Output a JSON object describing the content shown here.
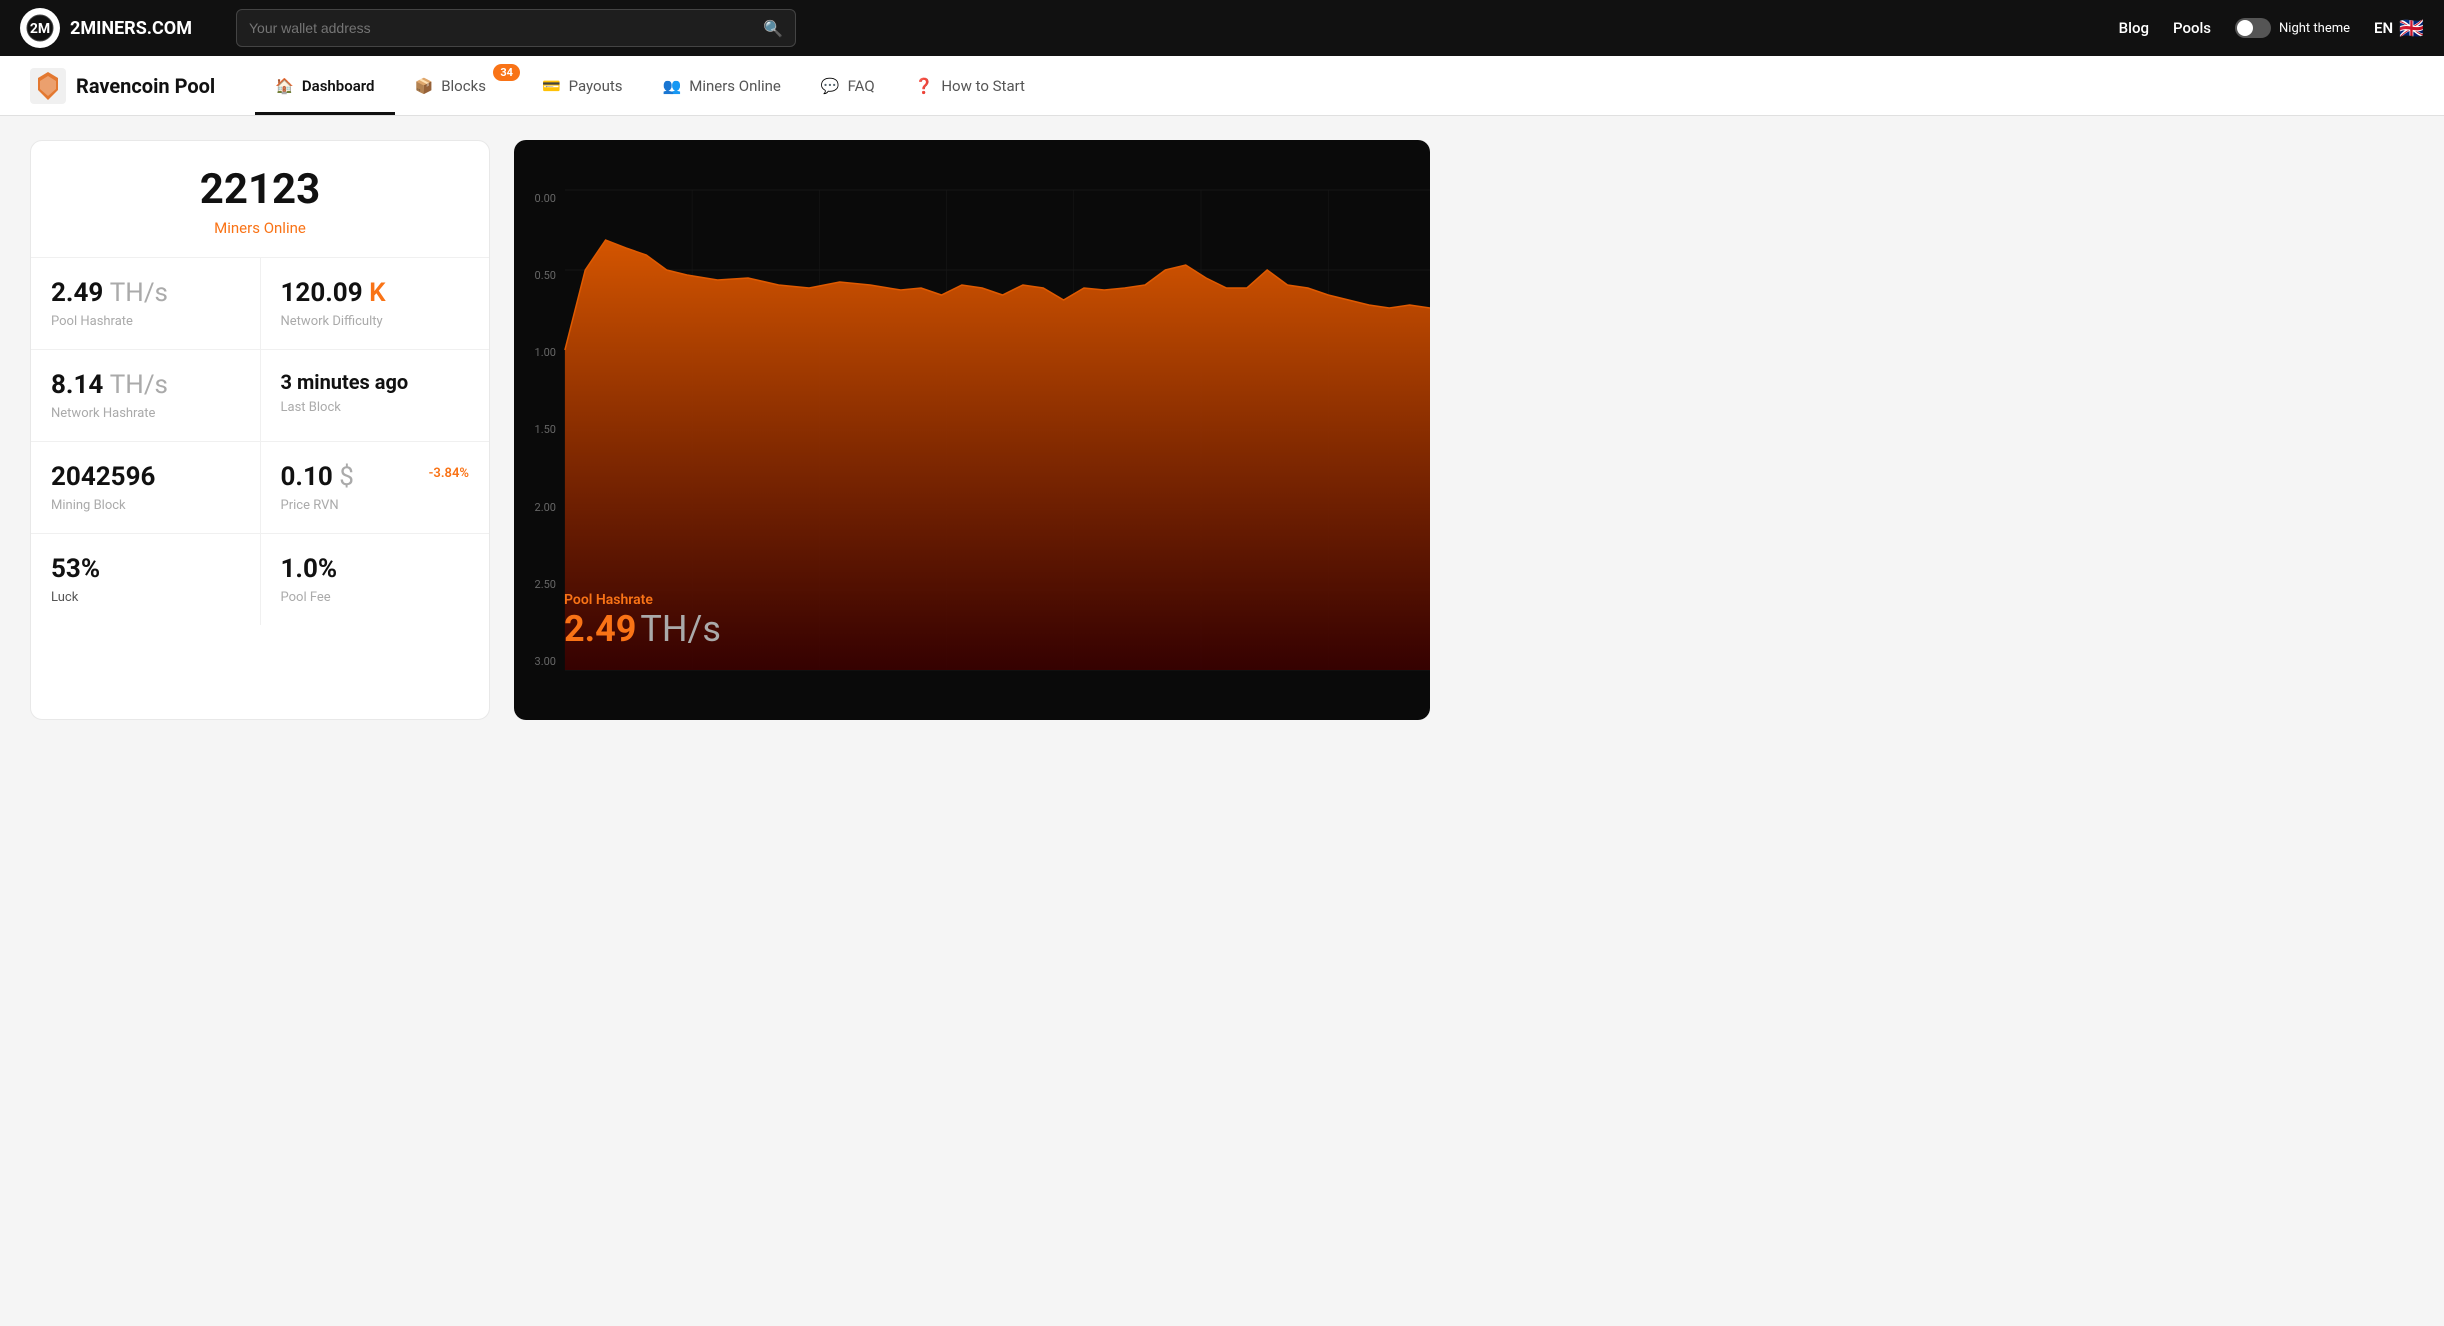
{
  "topnav": {
    "brand": "2MINERS.COM",
    "search_placeholder": "Your wallet address",
    "blog_label": "Blog",
    "pools_label": "Pools",
    "night_theme_label": "Night theme",
    "lang": "EN"
  },
  "subnav": {
    "title": "Ravencoin Pool",
    "tabs": [
      {
        "id": "dashboard",
        "label": "Dashboard",
        "icon": "🏠",
        "active": true,
        "badge": null
      },
      {
        "id": "blocks",
        "label": "Blocks",
        "icon": "📦",
        "active": false,
        "badge": "34"
      },
      {
        "id": "payouts",
        "label": "Payouts",
        "icon": "💳",
        "active": false,
        "badge": null
      },
      {
        "id": "miners-online",
        "label": "Miners Online",
        "icon": "👥",
        "active": false,
        "badge": null
      },
      {
        "id": "faq",
        "label": "FAQ",
        "icon": "💬",
        "active": false,
        "badge": null
      },
      {
        "id": "how-to-start",
        "label": "How to Start",
        "icon": "❓",
        "active": false,
        "badge": null
      }
    ]
  },
  "stats": {
    "miners_count": "22123",
    "miners_label": "Miners",
    "miners_status": "Online",
    "pool_hashrate_value": "2.49",
    "pool_hashrate_unit": "TH/s",
    "pool_hashrate_label": "Pool",
    "pool_hashrate_sublabel": "Hashrate",
    "network_difficulty_value": "120.09",
    "network_difficulty_suffix": "K",
    "network_difficulty_label": "Network",
    "network_difficulty_sublabel": "Difficulty",
    "network_hashrate_value": "8.14",
    "network_hashrate_unit": "TH/s",
    "network_hashrate_label": "Network",
    "network_hashrate_sublabel": "Hashrate",
    "last_block_value": "3 minutes ago",
    "last_block_label": "Last",
    "last_block_sublabel": "Block",
    "mining_block_value": "2042596",
    "mining_block_label": "Mining",
    "mining_block_sublabel": "Block",
    "price_value": "0.10",
    "price_currency": "$",
    "price_label": "Price",
    "price_sublabel": "RVN",
    "price_change": "-3.84%",
    "luck_value": "53%",
    "luck_label": "Luck",
    "pool_fee_value": "1.0%",
    "pool_fee_label": "Pool",
    "pool_fee_sublabel": "Fee"
  },
  "chart": {
    "overlay_label": "Pool Hashrate",
    "overlay_value": "2.49",
    "overlay_unit": "TH/s",
    "y_labels": [
      "0.00",
      "0.50",
      "1.00",
      "1.50",
      "2.00",
      "2.50",
      "3.00"
    ],
    "accent_color": "#c0392b",
    "fill_start": "#d45500",
    "fill_end": "#3a0000"
  }
}
